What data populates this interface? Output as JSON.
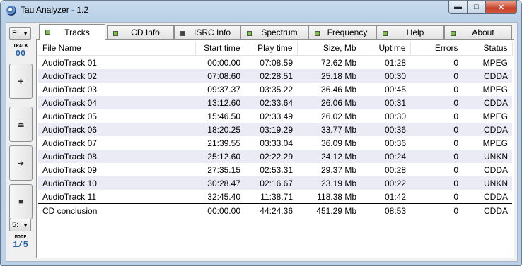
{
  "window": {
    "title": "Tau Analyzer - 1.2"
  },
  "left": {
    "drive": "F:",
    "track_caption": "TRACK",
    "track_value": "00",
    "buttons": [
      "+",
      "eject",
      "next",
      "stop"
    ],
    "speed": "5:",
    "mode_caption": "MODE",
    "mode_value": "1/5"
  },
  "tabs": [
    {
      "label": "Tracks",
      "active": true,
      "led": "on"
    },
    {
      "label": "CD Info",
      "led": "on"
    },
    {
      "label": "ISRC Info",
      "led": "off"
    },
    {
      "label": "Spectrum",
      "led": "on"
    },
    {
      "label": "Frequency",
      "led": "on"
    },
    {
      "label": "Help",
      "led": "on"
    },
    {
      "label": "About",
      "led": "on"
    }
  ],
  "table": {
    "headers": [
      "File Name",
      "Start time",
      "Play time",
      "Size, Mb",
      "Uptime",
      "Errors",
      "Status"
    ],
    "rows": [
      [
        "AudioTrack 01",
        "00:00.00",
        "07:08.59",
        "72.62 Mb",
        "01:28",
        "0",
        "MPEG"
      ],
      [
        "AudioTrack 02",
        "07:08.60",
        "02:28.51",
        "25.18 Mb",
        "00:30",
        "0",
        "CDDA"
      ],
      [
        "AudioTrack 03",
        "09:37.37",
        "03:35.22",
        "36.46 Mb",
        "00:45",
        "0",
        "MPEG"
      ],
      [
        "AudioTrack 04",
        "13:12.60",
        "02:33.64",
        "26.06 Mb",
        "00:31",
        "0",
        "CDDA"
      ],
      [
        "AudioTrack 05",
        "15:46.50",
        "02:33.49",
        "26.02 Mb",
        "00:30",
        "0",
        "MPEG"
      ],
      [
        "AudioTrack 06",
        "18:20.25",
        "03:19.29",
        "33.77 Mb",
        "00:36",
        "0",
        "CDDA"
      ],
      [
        "AudioTrack 07",
        "21:39.55",
        "03:33.04",
        "36.09 Mb",
        "00:36",
        "0",
        "MPEG"
      ],
      [
        "AudioTrack 08",
        "25:12.60",
        "02:22.29",
        "24.12 Mb",
        "00:24",
        "0",
        "UNKN"
      ],
      [
        "AudioTrack 09",
        "27:35.15",
        "02:53.31",
        "29.37 Mb",
        "00:28",
        "0",
        "CDDA"
      ],
      [
        "AudioTrack 10",
        "30:28.47",
        "02:16.67",
        "23.19 Mb",
        "00:22",
        "0",
        "UNKN"
      ],
      [
        "AudioTrack 11",
        "32:45.40",
        "11:38.71",
        "118.38 Mb",
        "01:42",
        "0",
        "CDDA"
      ]
    ],
    "total": [
      "CD conclusion",
      "00:00.00",
      "44:24.36",
      "451.29 Mb",
      "08:53",
      "0",
      "CDDA"
    ]
  }
}
